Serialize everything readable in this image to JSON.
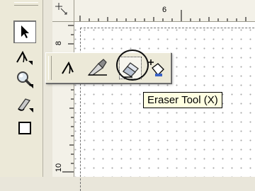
{
  "tooltip": {
    "text": "Eraser Tool (X)"
  },
  "ruler": {
    "top_label": "6",
    "left_labels": [
      "8",
      "10"
    ]
  },
  "toolbox": {
    "tools": [
      {
        "name": "pick-tool",
        "icon": "arrow-cursor-icon",
        "active": true
      },
      {
        "name": "shape-tool",
        "icon": "shape-edit-icon"
      },
      {
        "name": "zoom-tool",
        "icon": "magnifier-icon"
      },
      {
        "name": "freehand-tool",
        "icon": "pen-nib-icon"
      },
      {
        "name": "rectangle-tool",
        "icon": "rectangle-icon"
      }
    ]
  },
  "flyout": {
    "tools": [
      {
        "name": "shape-tool",
        "icon": "shape-edit-icon"
      },
      {
        "name": "knife-tool",
        "icon": "knife-icon"
      },
      {
        "name": "eraser-tool",
        "icon": "eraser-icon",
        "hovered": true
      },
      {
        "name": "transform-tool",
        "icon": "free-transform-icon"
      }
    ]
  },
  "colors": {
    "ui_face": "#ece9d8",
    "tooltip_bg": "#ffffe1",
    "grid_dot": "#a8a8a8"
  }
}
